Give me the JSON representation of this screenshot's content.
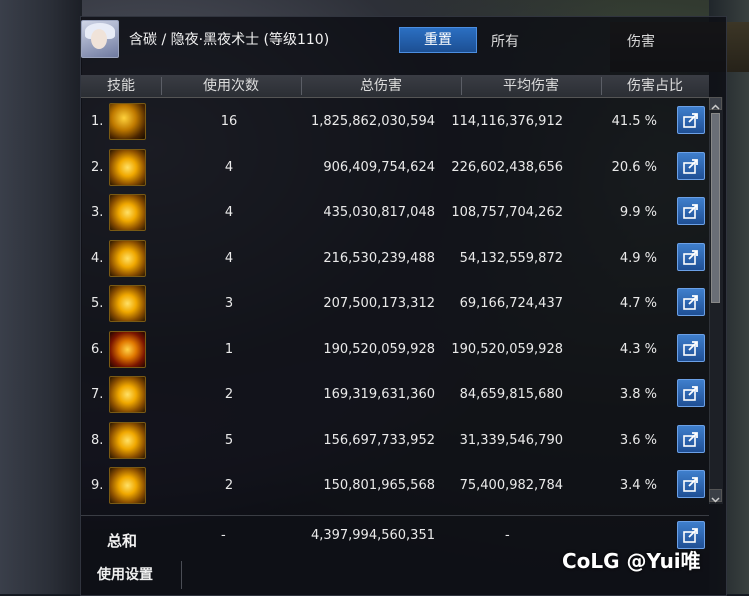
{
  "window": {
    "character_name": "含碳 / 隐夜·黑夜术士 (等级110)",
    "reset_label": "重置",
    "all_tab": "所有",
    "damage_tab": "伤害"
  },
  "header": {
    "skill": "技能",
    "uses": "使用次数",
    "total": "总伤害",
    "avg": "平均伤害",
    "share": "伤害占比"
  },
  "rows": [
    {
      "rank": "1.",
      "uses": "16",
      "total": "1,825,862,030,594",
      "avg": "114,116,376,912",
      "pct": "41.5 %"
    },
    {
      "rank": "2.",
      "uses": "4",
      "total": "906,409,754,624",
      "avg": "226,602,438,656",
      "pct": "20.6 %"
    },
    {
      "rank": "3.",
      "uses": "4",
      "total": "435,030,817,048",
      "avg": "108,757,704,262",
      "pct": "9.9 %"
    },
    {
      "rank": "4.",
      "uses": "4",
      "total": "216,530,239,488",
      "avg": "54,132,559,872",
      "pct": "4.9 %"
    },
    {
      "rank": "5.",
      "uses": "3",
      "total": "207,500,173,312",
      "avg": "69,166,724,437",
      "pct": "4.7 %"
    },
    {
      "rank": "6.",
      "uses": "1",
      "total": "190,520,059,928",
      "avg": "190,520,059,928",
      "pct": "4.3 %"
    },
    {
      "rank": "7.",
      "uses": "2",
      "total": "169,319,631,360",
      "avg": "84,659,815,680",
      "pct": "3.8 %"
    },
    {
      "rank": "8.",
      "uses": "5",
      "total": "156,697,733,952",
      "avg": "31,339,546,790",
      "pct": "3.6 %"
    },
    {
      "rank": "9.",
      "uses": "2",
      "total": "150,801,965,568",
      "avg": "75,400,982,784",
      "pct": "3.4 %"
    }
  ],
  "summary": {
    "label": "总和",
    "uses": "-",
    "total": "4,397,994,560,351",
    "avg": "-"
  },
  "settings_label": "使用设置",
  "watermark": "CoLG @Yui唯",
  "colors": {
    "accent": "#2b6fc2",
    "icon_gold": "#f0a800"
  }
}
